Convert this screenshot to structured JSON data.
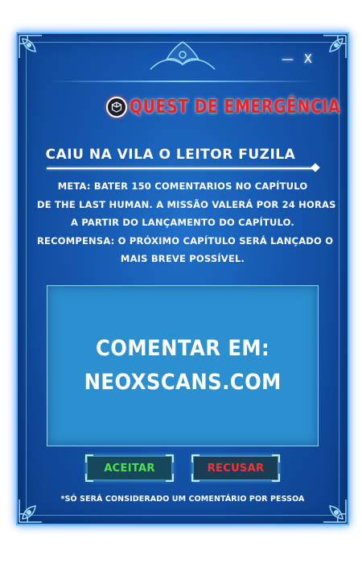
{
  "window_controls": {
    "minimize_icon": "—",
    "close_icon": "X"
  },
  "quest": {
    "title": "QUEST DE EMERGÊNCIA",
    "title_color": "#e5232b",
    "mission_name": "CAIU NA VILA O LEITOR FUZILA",
    "description_lines": [
      "META: BATER 150 COMENTARIOS NO CAPÍTULO",
      "DE THE LAST HUMAN. A MISSÃO VALERÁ POR 24 HORAS",
      "A PARTIR DO LANÇAMENTO DO CAPÍTULO.",
      "RECOMPENSA: O PRÓXIMO CAPÍTULO SERÁ LANÇADO O",
      "MAIS BREVE POSSÍVEL."
    ]
  },
  "comment_box": {
    "line1": "COMENTAR EM:",
    "line2": "NEOXSCANS.COM"
  },
  "buttons": {
    "accept_label": "ACEITAR",
    "refuse_label": "RECUSAR",
    "accept_color": "#4fe24a",
    "refuse_color": "#ff2f2f"
  },
  "footnote": "*SÓ SERÁ CONSIDERADO UM COMENTÁRIO POR PESSOA",
  "colors": {
    "panel_blue": "#1556ad",
    "border_glow": "#5fb4ff",
    "comment_box_bg": "#2c8fcf"
  }
}
